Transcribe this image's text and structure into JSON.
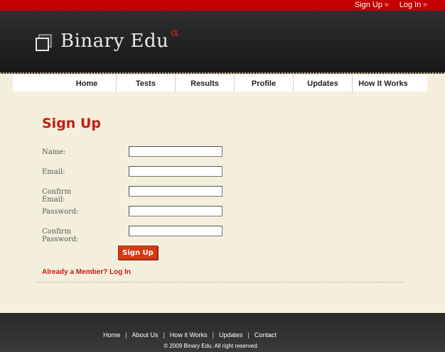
{
  "top_links": [
    {
      "label": "Sign Up",
      "arrow": "⊳"
    },
    {
      "label": "Log In",
      "arrow": "⊳"
    }
  ],
  "logo": {
    "text": "Binary Edu",
    "sup": "α"
  },
  "nav": [
    "Home",
    "Tests",
    "Results",
    "Profile",
    "Updates",
    "How It Works"
  ],
  "page_title": "Sign Up",
  "form": {
    "fields": [
      {
        "label": "Name:",
        "value": ""
      },
      {
        "label": "Email:",
        "value": ""
      },
      {
        "label": "Confirm Email:",
        "value": ""
      },
      {
        "label": "Password:",
        "value": ""
      },
      {
        "label": "Confirm Password:",
        "value": ""
      }
    ],
    "submit_label": "Sign Up"
  },
  "member_link": "Already a Member? Log In",
  "footer": {
    "links": [
      "Home",
      "About Us",
      "How it Works",
      "Updates",
      "Contact"
    ],
    "separator": "|",
    "copyright": "© 2009 Binary Edu. All right reserved."
  },
  "colors": {
    "accent": "#c81a12",
    "top_strip": "#c40000",
    "background": "#f3efdc"
  }
}
